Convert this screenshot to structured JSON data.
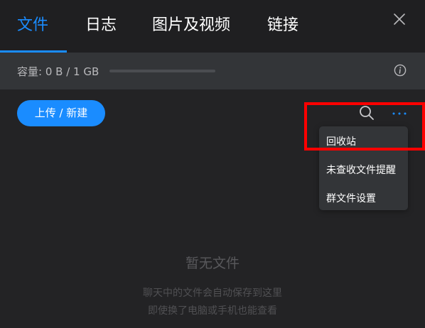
{
  "tabs": [
    {
      "label": "文件",
      "active": true
    },
    {
      "label": "日志",
      "active": false
    },
    {
      "label": "图片及视频",
      "active": false
    },
    {
      "label": "链接",
      "active": false
    }
  ],
  "window": {
    "close_icon": "close-icon"
  },
  "storage": {
    "label": "容量: 0 B / 1 GB",
    "used_fraction": 0.0,
    "info_icon": "info-icon"
  },
  "toolbar": {
    "upload_label": "上传 / 新建",
    "search_icon": "search-icon",
    "more_icon": "more-horizontal-icon"
  },
  "menu": {
    "items": [
      {
        "label": "回收站"
      },
      {
        "label": "未查收文件提醒"
      },
      {
        "label": "群文件设置"
      }
    ]
  },
  "empty_state": {
    "title": "暂无文件",
    "line1": "聊天中的文件会自动保存到这里",
    "line2": "即使换了电脑或手机也能查看"
  },
  "colors": {
    "accent": "#1a8cff",
    "background": "#232325",
    "panel": "#333538",
    "highlight": "#ff0000"
  }
}
